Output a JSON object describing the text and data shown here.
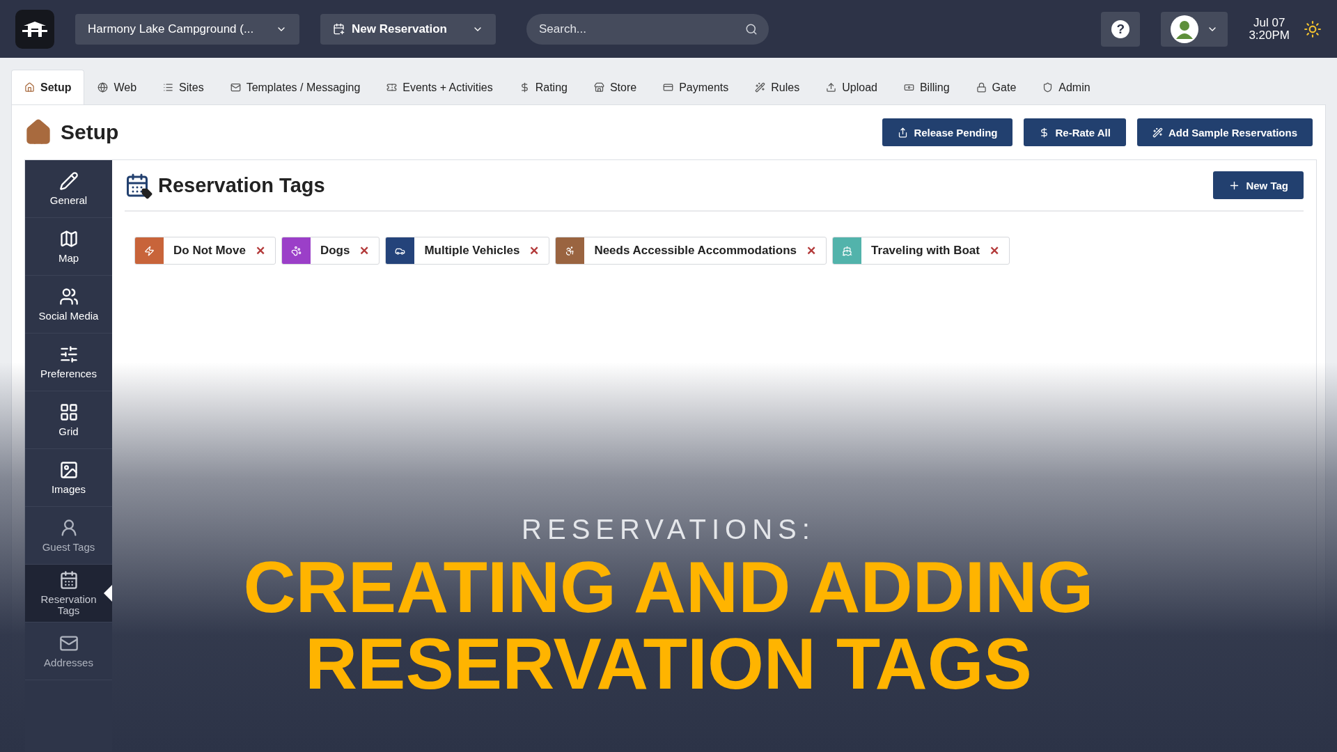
{
  "top_bar": {
    "campground_select": "Harmony Lake Campground (...",
    "new_reservation": "New Reservation",
    "search": {
      "placeholder": "Search..."
    },
    "help": "?",
    "date": "Jul 07",
    "time": "3:20PM"
  },
  "tabs": [
    {
      "label": "Setup",
      "selected": true
    },
    {
      "label": "Web",
      "selected": false
    },
    {
      "label": "Sites",
      "selected": false
    },
    {
      "label": "Templates / Messaging",
      "selected": false
    },
    {
      "label": "Events + Activities",
      "selected": false
    },
    {
      "label": "Rating",
      "selected": false
    },
    {
      "label": "Store",
      "selected": false
    },
    {
      "label": "Payments",
      "selected": false
    },
    {
      "label": "Rules",
      "selected": false
    },
    {
      "label": "Upload",
      "selected": false
    },
    {
      "label": "Billing",
      "selected": false
    },
    {
      "label": "Gate",
      "selected": false
    },
    {
      "label": "Admin",
      "selected": false
    }
  ],
  "page": {
    "title": "Setup",
    "actions": [
      "Release Pending",
      "Re-Rate All",
      "Add Sample Reservations"
    ]
  },
  "sidebar": [
    {
      "label": "General",
      "selected": false
    },
    {
      "label": "Map",
      "selected": false
    },
    {
      "label": "Social Media",
      "selected": false
    },
    {
      "label": "Preferences",
      "selected": false
    },
    {
      "label": "Grid",
      "selected": false
    },
    {
      "label": "Images",
      "selected": false
    },
    {
      "label": "Guest Tags",
      "selected": false
    },
    {
      "label": "Reservation Tags",
      "selected": true
    },
    {
      "label": "Addresses",
      "selected": false
    }
  ],
  "panel": {
    "title": "Reservation Tags",
    "new_button": "New Tag",
    "tags": [
      {
        "label": "Do Not Move",
        "color": "#c8643a",
        "remove": "✕"
      },
      {
        "label": "Dogs",
        "color": "#9b3fc8",
        "remove": "✕"
      },
      {
        "label": "Multiple Vehicles",
        "color": "#24437a",
        "remove": "✕"
      },
      {
        "label": "Needs Accessible Accommodations",
        "color": "#9a6440",
        "remove": "✕"
      },
      {
        "label": "Traveling with Boat",
        "color": "#52b3ab",
        "remove": "✕"
      }
    ]
  },
  "overlay": {
    "kicker": "RESERVATIONS:",
    "title_lines": [
      "CREATING AND ADDING",
      "RESERVATION TAGS"
    ]
  }
}
